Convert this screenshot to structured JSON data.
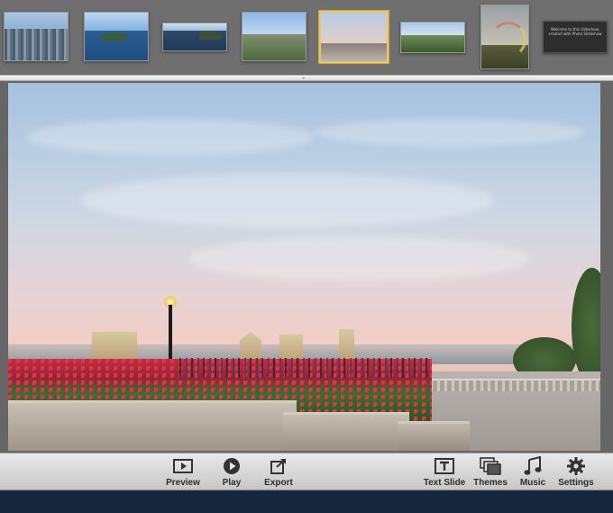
{
  "filmstrip": {
    "thumbnails": [
      {
        "label": "city-skyline-photo"
      },
      {
        "label": "island-bay-photo"
      },
      {
        "label": "river-panorama-photo"
      },
      {
        "label": "green-valley-photo"
      },
      {
        "label": "belvedere-sunset-photo",
        "selected": true
      },
      {
        "label": "forest-horizon-photo"
      },
      {
        "label": "rainbow-photo"
      },
      {
        "label": "text-slide",
        "text": "Welcome to this slideshow, created with Photo Slideshow"
      }
    ]
  },
  "toolbar": {
    "preview_label": "Preview",
    "play_label": "Play",
    "export_label": "Export",
    "text_slide_label": "Text Slide",
    "themes_label": "Themes",
    "music_label": "Music",
    "settings_label": "Settings"
  },
  "colors": {
    "selection": "#e7c766",
    "toolbar_bg": "#d8d8d8",
    "bottom_bar": "#17283c"
  }
}
